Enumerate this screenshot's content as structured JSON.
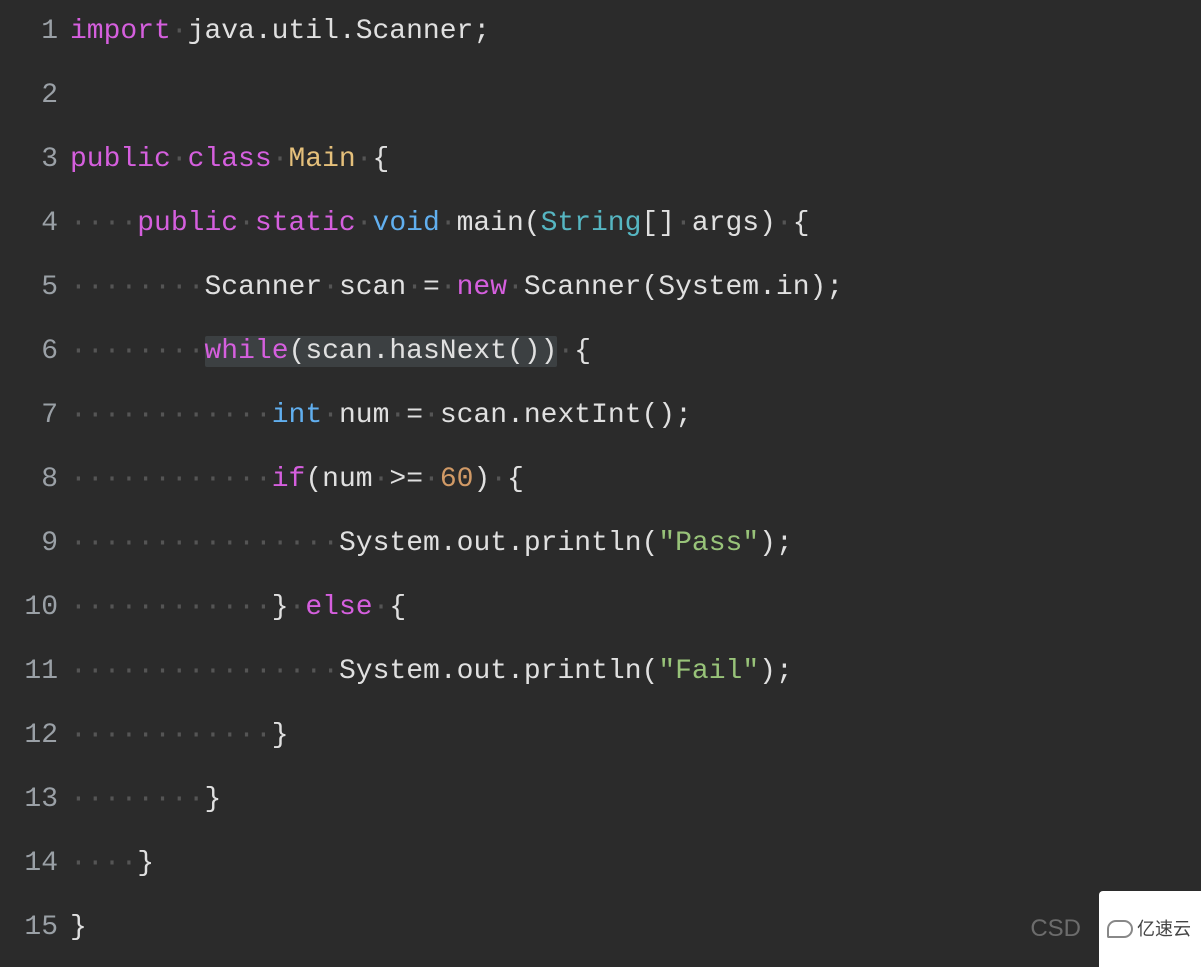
{
  "editor": {
    "line_numbers": [
      "1",
      "2",
      "3",
      "4",
      "5",
      "6",
      "7",
      "8",
      "9",
      "10",
      "11",
      "12",
      "13",
      "14",
      "15"
    ],
    "whitespace_char": "·",
    "lines": [
      {
        "indent": 0,
        "tokens": [
          {
            "t": "import",
            "c": "kw-import"
          },
          {
            "t": "·",
            "c": "ws-dot"
          },
          {
            "t": "java",
            "c": "ident"
          },
          {
            "t": ".",
            "c": "punct"
          },
          {
            "t": "util",
            "c": "ident"
          },
          {
            "t": ".",
            "c": "punct"
          },
          {
            "t": "Scanner",
            "c": "ident"
          },
          {
            "t": ";",
            "c": "punct"
          }
        ]
      },
      {
        "indent": 0,
        "tokens": []
      },
      {
        "indent": 0,
        "tokens": [
          {
            "t": "public",
            "c": "kw-public"
          },
          {
            "t": "·",
            "c": "ws-dot"
          },
          {
            "t": "class",
            "c": "kw-class"
          },
          {
            "t": "·",
            "c": "ws-dot"
          },
          {
            "t": "Main",
            "c": "classname"
          },
          {
            "t": "·",
            "c": "ws-dot"
          },
          {
            "t": "{",
            "c": "punct"
          }
        ]
      },
      {
        "indent": 4,
        "tokens": [
          {
            "t": "public",
            "c": "kw-public"
          },
          {
            "t": "·",
            "c": "ws-dot"
          },
          {
            "t": "static",
            "c": "kw-static"
          },
          {
            "t": "·",
            "c": "ws-dot"
          },
          {
            "t": "void",
            "c": "kw-void"
          },
          {
            "t": "·",
            "c": "ws-dot"
          },
          {
            "t": "main",
            "c": "method"
          },
          {
            "t": "(",
            "c": "punct"
          },
          {
            "t": "String",
            "c": "type"
          },
          {
            "t": "[]",
            "c": "punct"
          },
          {
            "t": "·",
            "c": "ws-dot"
          },
          {
            "t": "args",
            "c": "ident"
          },
          {
            "t": ")",
            "c": "punct"
          },
          {
            "t": "·",
            "c": "ws-dot"
          },
          {
            "t": "{",
            "c": "punct"
          }
        ]
      },
      {
        "indent": 8,
        "tokens": [
          {
            "t": "Scanner",
            "c": "ident"
          },
          {
            "t": "·",
            "c": "ws-dot"
          },
          {
            "t": "scan",
            "c": "ident"
          },
          {
            "t": "·",
            "c": "ws-dot"
          },
          {
            "t": "=",
            "c": "punct"
          },
          {
            "t": "·",
            "c": "ws-dot"
          },
          {
            "t": "new",
            "c": "kw-new"
          },
          {
            "t": "·",
            "c": "ws-dot"
          },
          {
            "t": "Scanner",
            "c": "ident"
          },
          {
            "t": "(",
            "c": "punct"
          },
          {
            "t": "System",
            "c": "ident"
          },
          {
            "t": ".",
            "c": "punct"
          },
          {
            "t": "in",
            "c": "ident"
          },
          {
            "t": ")",
            "c": "punct"
          },
          {
            "t": ";",
            "c": "punct"
          }
        ]
      },
      {
        "indent": 8,
        "tokens": [
          {
            "t": "while",
            "c": "kw-while",
            "hl": true
          },
          {
            "t": "(",
            "c": "punct",
            "hl": true
          },
          {
            "t": "scan",
            "c": "ident",
            "hl": true
          },
          {
            "t": ".",
            "c": "punct",
            "hl": true
          },
          {
            "t": "hasNext",
            "c": "method",
            "hl": true
          },
          {
            "t": "()",
            "c": "punct",
            "hl": true
          },
          {
            "t": ")",
            "c": "punct",
            "hl": true
          },
          {
            "t": "·",
            "c": "ws-dot"
          },
          {
            "t": "{",
            "c": "punct"
          }
        ]
      },
      {
        "indent": 12,
        "tokens": [
          {
            "t": "int",
            "c": "kw-int"
          },
          {
            "t": "·",
            "c": "ws-dot"
          },
          {
            "t": "num",
            "c": "ident"
          },
          {
            "t": "·",
            "c": "ws-dot"
          },
          {
            "t": "=",
            "c": "punct"
          },
          {
            "t": "·",
            "c": "ws-dot"
          },
          {
            "t": "scan",
            "c": "ident"
          },
          {
            "t": ".",
            "c": "punct"
          },
          {
            "t": "nextInt",
            "c": "method"
          },
          {
            "t": "()",
            "c": "punct"
          },
          {
            "t": ";",
            "c": "punct"
          }
        ]
      },
      {
        "indent": 12,
        "tokens": [
          {
            "t": "if",
            "c": "kw-if"
          },
          {
            "t": "(",
            "c": "punct"
          },
          {
            "t": "num",
            "c": "ident"
          },
          {
            "t": "·",
            "c": "ws-dot"
          },
          {
            "t": ">=",
            "c": "punct"
          },
          {
            "t": "·",
            "c": "ws-dot"
          },
          {
            "t": "60",
            "c": "number"
          },
          {
            "t": ")",
            "c": "punct"
          },
          {
            "t": "·",
            "c": "ws-dot"
          },
          {
            "t": "{",
            "c": "punct"
          }
        ]
      },
      {
        "indent": 16,
        "tokens": [
          {
            "t": "System",
            "c": "ident"
          },
          {
            "t": ".",
            "c": "punct"
          },
          {
            "t": "out",
            "c": "ident"
          },
          {
            "t": ".",
            "c": "punct"
          },
          {
            "t": "println",
            "c": "method"
          },
          {
            "t": "(",
            "c": "punct"
          },
          {
            "t": "\"Pass\"",
            "c": "string"
          },
          {
            "t": ")",
            "c": "punct"
          },
          {
            "t": ";",
            "c": "punct"
          }
        ]
      },
      {
        "indent": 12,
        "tokens": [
          {
            "t": "}",
            "c": "punct"
          },
          {
            "t": "·",
            "c": "ws-dot"
          },
          {
            "t": "else",
            "c": "kw-else"
          },
          {
            "t": "·",
            "c": "ws-dot"
          },
          {
            "t": "{",
            "c": "punct"
          }
        ]
      },
      {
        "indent": 16,
        "tokens": [
          {
            "t": "System",
            "c": "ident"
          },
          {
            "t": ".",
            "c": "punct"
          },
          {
            "t": "out",
            "c": "ident"
          },
          {
            "t": ".",
            "c": "punct"
          },
          {
            "t": "println",
            "c": "method"
          },
          {
            "t": "(",
            "c": "punct"
          },
          {
            "t": "\"Fail\"",
            "c": "string"
          },
          {
            "t": ")",
            "c": "punct"
          },
          {
            "t": ";",
            "c": "punct"
          }
        ]
      },
      {
        "indent": 12,
        "tokens": [
          {
            "t": "}",
            "c": "punct"
          }
        ]
      },
      {
        "indent": 8,
        "tokens": [
          {
            "t": "}",
            "c": "punct"
          }
        ]
      },
      {
        "indent": 4,
        "tokens": [
          {
            "t": "}",
            "c": "punct"
          }
        ]
      },
      {
        "indent": 0,
        "tokens": [
          {
            "t": "}",
            "c": "punct"
          }
        ]
      }
    ]
  },
  "watermarks": {
    "left": "CSD",
    "right": "亿速云"
  }
}
